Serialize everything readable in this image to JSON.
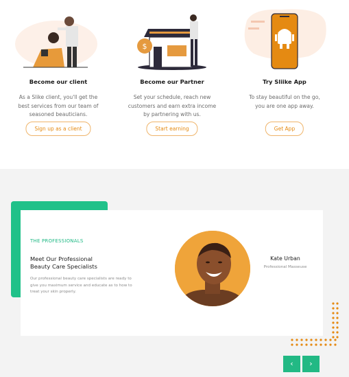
{
  "cards": [
    {
      "title": "Become our client",
      "desc_lines": [
        "As a Slike client, you'll get the",
        "best services from our team of",
        "seasoned beauticians."
      ],
      "button": "Sign up as a client"
    },
    {
      "title": "Become our Partner",
      "desc_lines": [
        "Set your schedule, reach new",
        "customers and earn extra income",
        "by partnering with us."
      ],
      "button": "Start earning"
    },
    {
      "title": "Try Sliike App",
      "desc_lines": [
        "To stay beautiful on the go,",
        "you are one app away."
      ],
      "button": "Get App"
    }
  ],
  "professionals": {
    "tag": "THE PROFESSIONALS",
    "headline_lines": [
      "Meet Our Professional",
      "Beauty Care Specialists"
    ],
    "blurb_lines": [
      "Our professional beauty care specialists are ready to",
      "give you maximum service and educate as to how to",
      "treat your skin properly."
    ],
    "person_name": "Kate Urban",
    "person_role": "Professional Masseuse",
    "prev_symbol": "‹",
    "next_symbol": "›"
  },
  "colors": {
    "accent": "#e58a12",
    "green": "#20c189",
    "bg_gray": "#f3f3f3"
  },
  "icons": [
    "barber-illustration",
    "house-shop-illustration",
    "android-phone-illustration",
    "chevron-left-icon",
    "chevron-right-icon"
  ]
}
